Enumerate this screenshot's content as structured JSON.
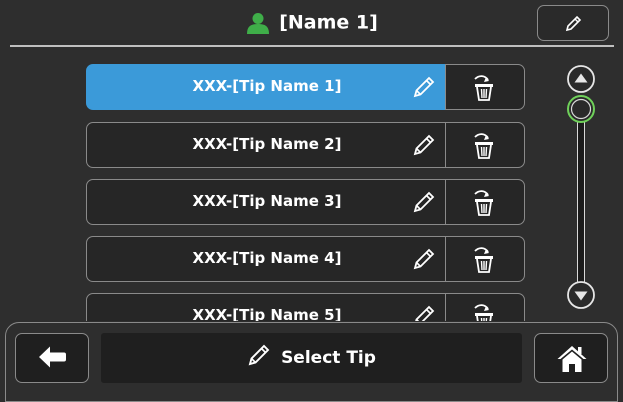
{
  "header": {
    "title": "[Name 1]"
  },
  "tips": [
    {
      "label": "XXX-[Tip Name 1]",
      "selected": true
    },
    {
      "label": "XXX-[Tip Name 2]",
      "selected": false
    },
    {
      "label": "XXX-[Tip Name 3]",
      "selected": false
    },
    {
      "label": "XXX-[Tip Name 4]",
      "selected": false
    },
    {
      "label": "XXX-[Tip Name 5]",
      "selected": false
    }
  ],
  "footer": {
    "select_label": "Select Tip"
  },
  "icons": {
    "user": "user-icon",
    "edit": "pencil-icon",
    "delete": "trash-icon",
    "back": "arrow-left-icon",
    "home": "home-icon",
    "scroll_up": "arrow-up-icon",
    "scroll_down": "arrow-down-icon"
  },
  "colors": {
    "selected": "#3b9ad9",
    "user_icon": "#3fae49",
    "scroll_thumb": "#6fd15a"
  }
}
